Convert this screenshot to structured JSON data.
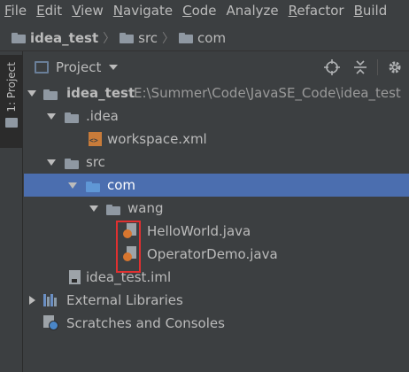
{
  "menubar": {
    "items": [
      {
        "mnemonic": "F",
        "rest": "ile"
      },
      {
        "mnemonic": "E",
        "rest": "dit"
      },
      {
        "mnemonic": "V",
        "rest": "iew"
      },
      {
        "mnemonic": "N",
        "rest": "avigate"
      },
      {
        "mnemonic": "C",
        "rest": "ode"
      },
      {
        "mnemonic": "",
        "rest": "Analyze"
      },
      {
        "mnemonic": "R",
        "rest": "efactor"
      },
      {
        "mnemonic": "B",
        "rest": "uild"
      }
    ]
  },
  "breadcrumb": {
    "items": [
      "idea_test",
      "src",
      "com"
    ]
  },
  "side_tab": {
    "label": "1: Project"
  },
  "panel": {
    "title": "Project",
    "icons": [
      "locate-icon",
      "collapse-all-icon",
      "settings-icon"
    ]
  },
  "tree": {
    "root_name": "idea_test",
    "root_path": "E:\\Summer\\Code\\JavaSE_Code\\idea_test",
    "idea_folder": ".idea",
    "workspace_file": "workspace.xml",
    "src_folder": "src",
    "com_folder": "com",
    "wang_folder": "wang",
    "file1": "HelloWorld.java",
    "file2": "OperatorDemo.java",
    "iml_file": "idea_test.iml",
    "external_libraries": "External Libraries",
    "scratches": "Scratches and Consoles"
  },
  "colors": {
    "background": "#3c3f41",
    "selection": "#4b6eaf",
    "highlight_border": "#e03030",
    "folder_blue": "#5f97d6",
    "folder_gray": "#8f98a2"
  }
}
